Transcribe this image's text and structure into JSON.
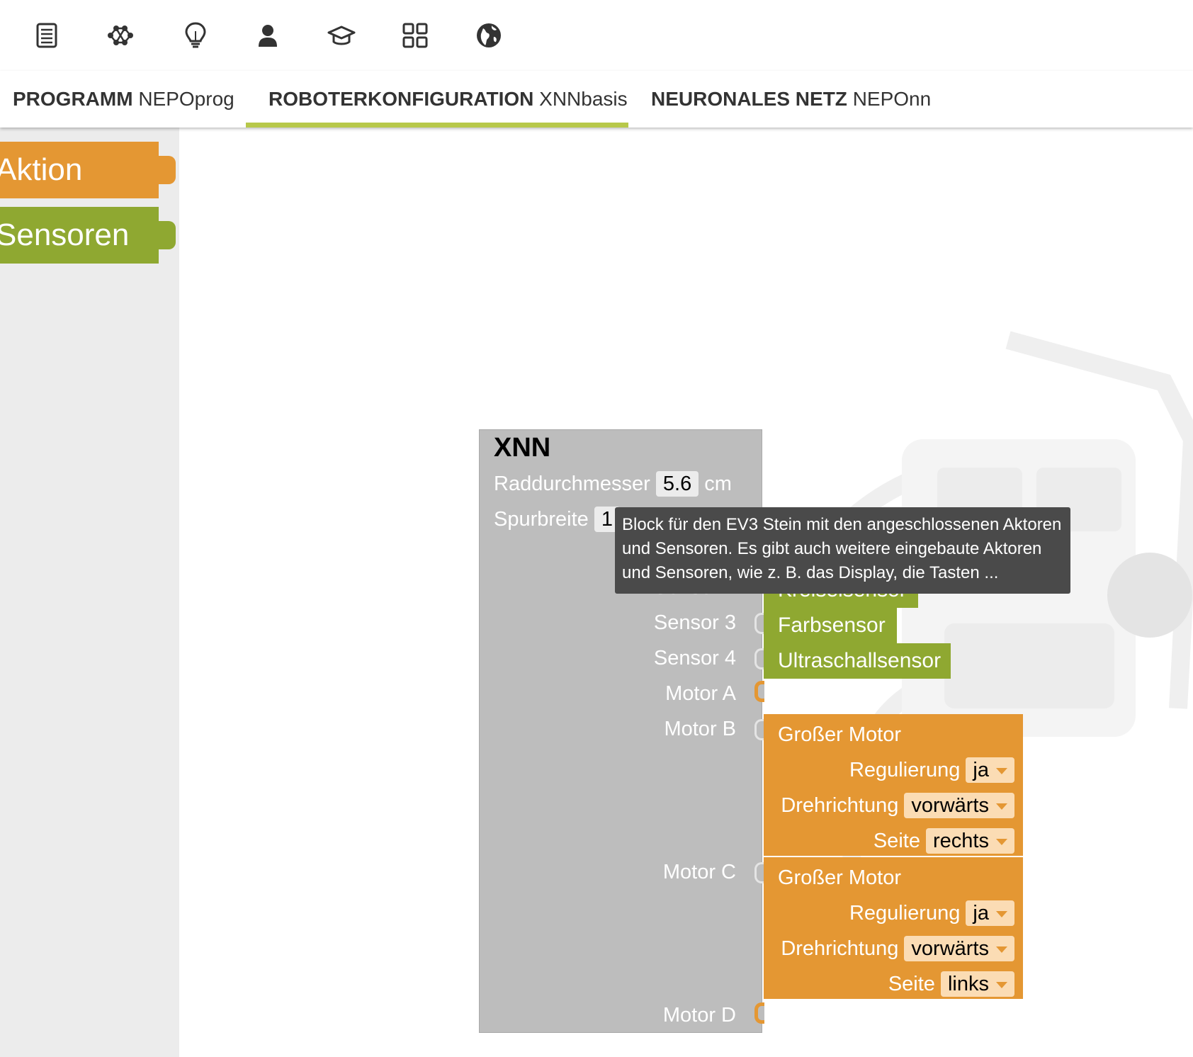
{
  "icons": [
    {
      "name": "program-list-icon"
    },
    {
      "name": "network-icon"
    },
    {
      "name": "lightbulb-icon"
    },
    {
      "name": "user-icon"
    },
    {
      "name": "graduation-cap-icon"
    },
    {
      "name": "apps-grid-icon"
    },
    {
      "name": "globe-icon"
    }
  ],
  "tabs": [
    {
      "bold": "PROGRAMM",
      "name": "NEPOprog",
      "active": false
    },
    {
      "bold": "ROBOTERKONFIGURATION",
      "name": "XNNbasis",
      "active": true
    },
    {
      "bold": "NEURONALES NETZ",
      "name": "NEPOnn",
      "active": false
    }
  ],
  "toolbox": {
    "categories": [
      {
        "label": "Aktion",
        "color": "#e49733"
      },
      {
        "label": "Sensoren",
        "color": "#8fa831"
      }
    ]
  },
  "brick": {
    "title": "XNN",
    "wheel_label": "Raddurchmesser",
    "wheel_value": "5.6",
    "wheel_unit": "cm",
    "track_label": "Spurbreite",
    "track_value_visible": "1",
    "ports": {
      "sensor2": "Sensor 2",
      "sensor3": "Sensor 3",
      "sensor4": "Sensor 4",
      "motorA": "Motor A",
      "motorB": "Motor B",
      "motorC": "Motor C",
      "motorD": "Motor D"
    }
  },
  "sensors": {
    "sensor2": "Kreiselsensor",
    "sensor3": "Farbsensor",
    "sensor4": "Ultraschallsensor"
  },
  "motors": [
    {
      "title": "Großer Motor",
      "reg_label": "Regulierung",
      "reg_value": "ja",
      "dir_label": "Drehrichtung",
      "dir_value": "vorwärts",
      "side_label": "Seite",
      "side_value": "rechts"
    },
    {
      "title": "Großer Motor",
      "reg_label": "Regulierung",
      "reg_value": "ja",
      "dir_label": "Drehrichtung",
      "dir_value": "vorwärts",
      "side_label": "Seite",
      "side_value": "links"
    }
  ],
  "tooltip": {
    "text": "Block für den EV3 Stein mit den angeschlossenen Aktoren und Sensoren. Es gibt auch weitere eingebaute Aktoren und Sensoren, wie z. B. das Display, die Tasten ..."
  },
  "colors": {
    "action": "#e49733",
    "sensor": "#8fa831",
    "tab_active_underline": "#b7c84a",
    "brick": "#bdbdbd",
    "tooltip_bg": "#4a4a4a"
  }
}
